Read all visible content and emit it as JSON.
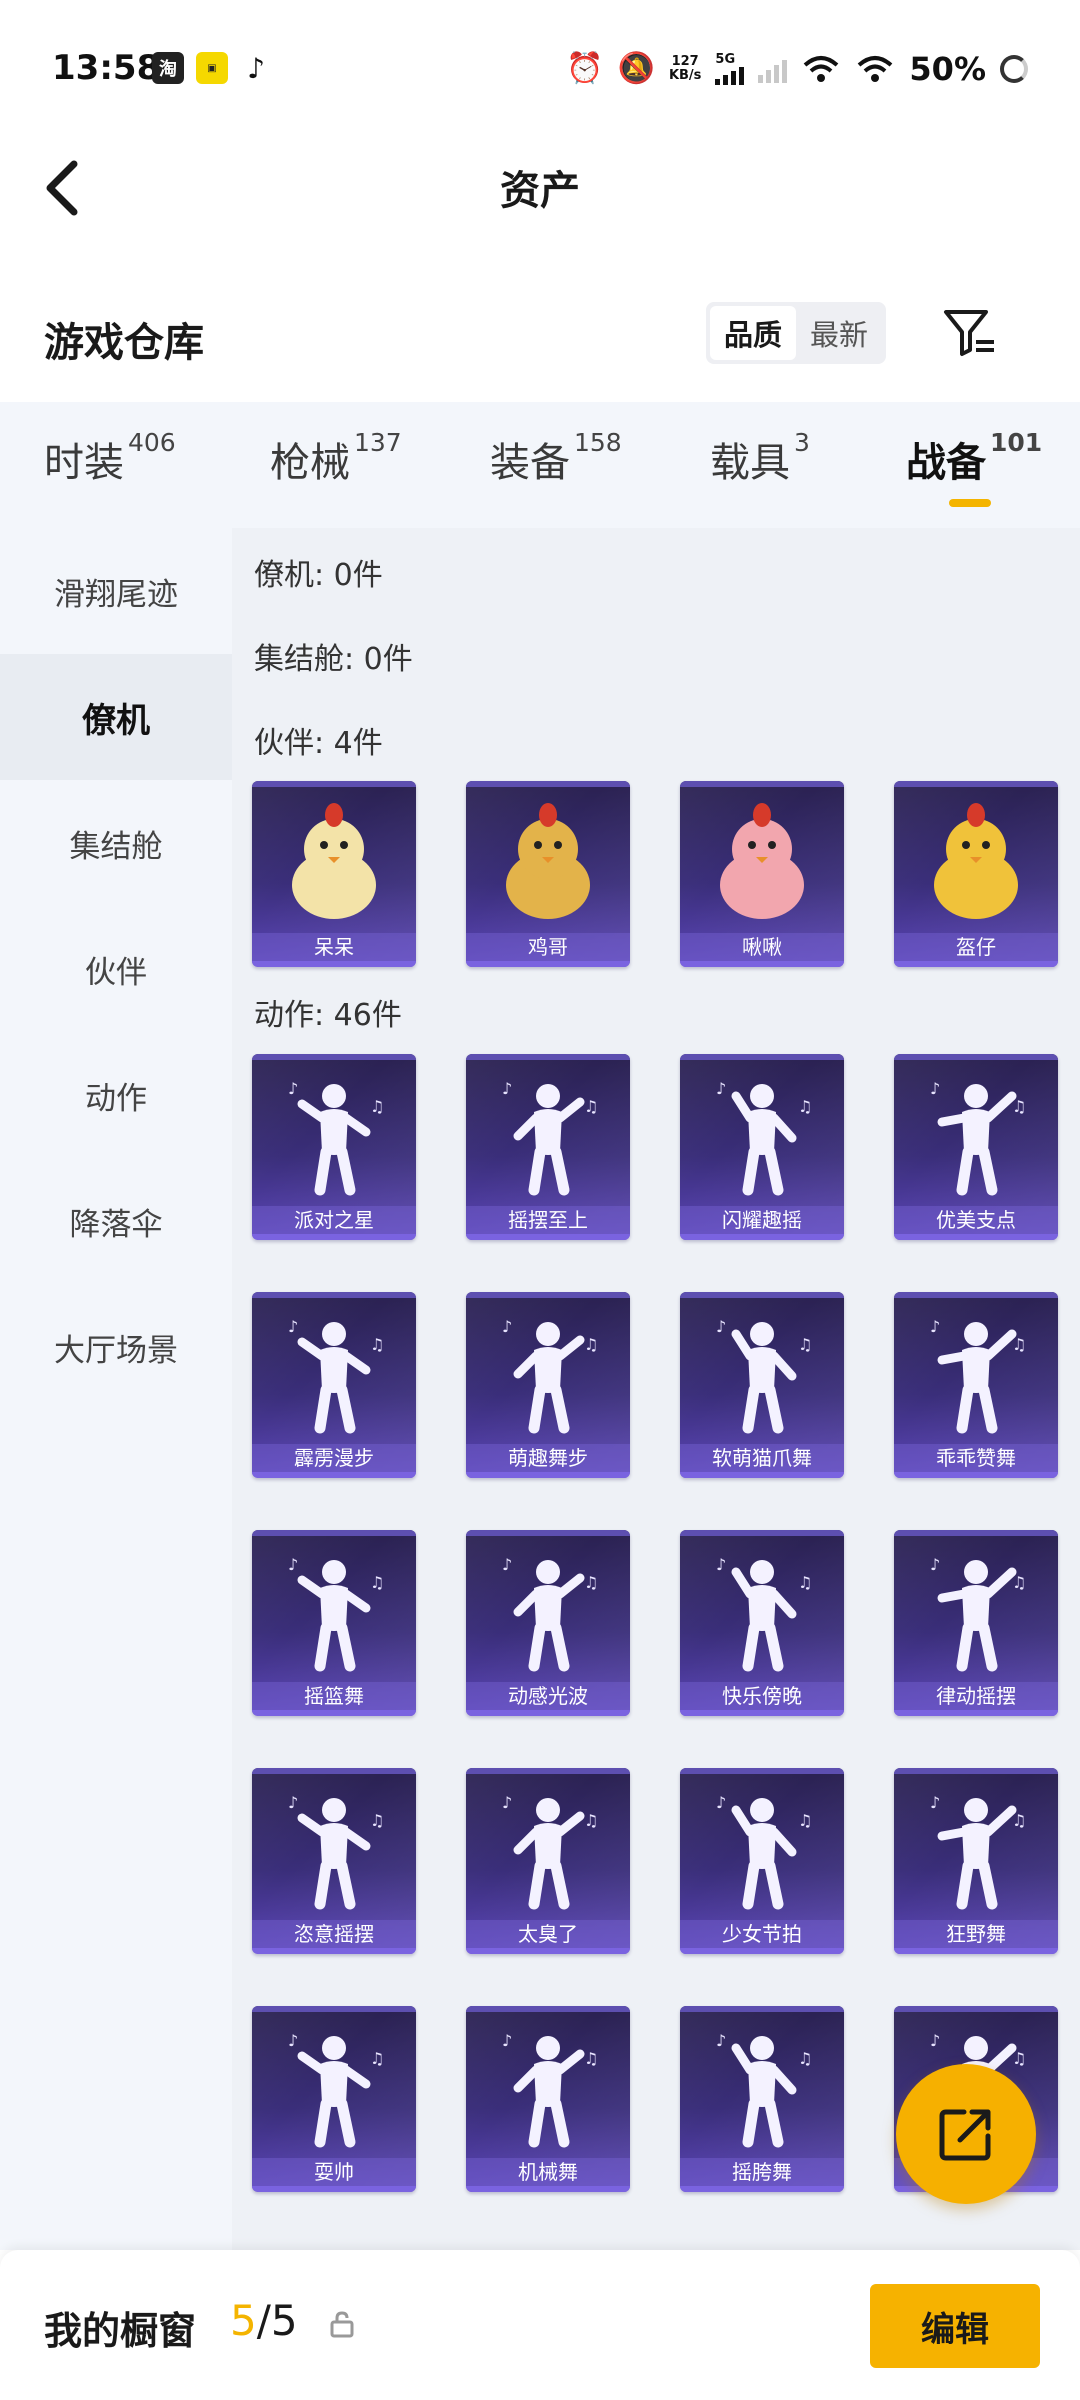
{
  "status_bar": {
    "time": "13:58",
    "net_speed_value": "127",
    "net_speed_unit": "KB/s",
    "network_type": "5G",
    "battery": "50%"
  },
  "header": {
    "title": "资产"
  },
  "section": {
    "title": "游戏仓库",
    "sort_options": [
      "品质",
      "最新"
    ],
    "sort_selected": "品质"
  },
  "tabs": [
    {
      "label": "时装",
      "count": "406"
    },
    {
      "label": "枪械",
      "count": "137"
    },
    {
      "label": "装备",
      "count": "158"
    },
    {
      "label": "载具",
      "count": "3"
    },
    {
      "label": "战备",
      "count": "101"
    }
  ],
  "active_tab": "战备",
  "sidebar": [
    {
      "label": "滑翔尾迹"
    },
    {
      "label": "僚机"
    },
    {
      "label": "集结舱"
    },
    {
      "label": "伙伴"
    },
    {
      "label": "动作"
    },
    {
      "label": "降落伞"
    },
    {
      "label": "大厅场景"
    }
  ],
  "active_sidebar": "僚机",
  "groups": [
    {
      "label": "僚机: 0件",
      "items": []
    },
    {
      "label": "集结舱: 0件",
      "items": []
    },
    {
      "label": "伙伴: 4件",
      "items": [
        "呆呆",
        "鸡哥",
        "啾啾",
        "盔仔"
      ]
    },
    {
      "label": "动作: 46件",
      "items": [
        "派对之星",
        "摇摆至上",
        "闪耀趣摇",
        "优美支点",
        "霹雳漫步",
        "萌趣舞步",
        "软萌猫爪舞",
        "乖乖赞舞",
        "摇篮舞",
        "动感光波",
        "快乐傍晚",
        "律动摇摆",
        "恣意摇摆",
        "太臭了",
        "少女节拍",
        "狂野舞",
        "耍帅",
        "机械舞",
        "摇胯舞",
        ""
      ]
    }
  ],
  "bottom_bar": {
    "title": "我的橱窗",
    "count_current": "5",
    "count_total": "/5",
    "edit_label": "编辑"
  },
  "colors": {
    "accent": "#f4b400",
    "card_dark": "#2a2150",
    "card_light": "#5b45b8",
    "sidebar_bg": "#f3f6fb",
    "content_bg": "#eef1f6"
  }
}
